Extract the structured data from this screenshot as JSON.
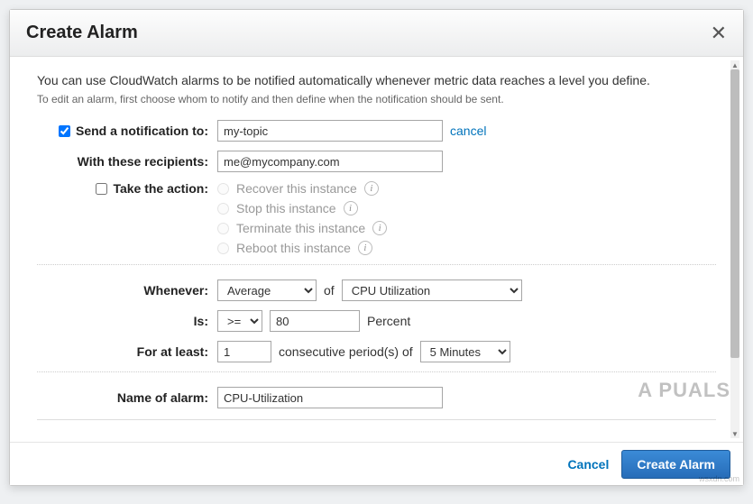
{
  "dialog": {
    "title": "Create Alarm",
    "close_label": "✕"
  },
  "intro": "You can use CloudWatch alarms to be notified automatically whenever metric data reaches a level you define.",
  "sub_intro": "To edit an alarm, first choose whom to notify and then define when the notification should be sent.",
  "notification": {
    "send_label": "Send a notification to:",
    "send_checked": true,
    "topic_value": "my-topic",
    "cancel_link": "cancel",
    "recipients_label": "With these recipients:",
    "recipients_value": "me@mycompany.com"
  },
  "action": {
    "take_label": "Take the action:",
    "take_checked": false,
    "options": {
      "recover": "Recover this instance",
      "stop": "Stop this instance",
      "terminate": "Terminate this instance",
      "reboot": "Reboot this instance"
    }
  },
  "threshold": {
    "whenever_label": "Whenever:",
    "statistic_value": "Average",
    "of_text": "of",
    "metric_value": "CPU Utilization",
    "is_label": "Is:",
    "operator_value": ">=",
    "threshold_value": "80",
    "percent_text": "Percent",
    "for_label": "For at least:",
    "periods_value": "1",
    "consecutive_text": "consecutive period(s) of",
    "period_value": "5 Minutes"
  },
  "name": {
    "label": "Name of alarm:",
    "value": "CPU-Utilization"
  },
  "footer": {
    "cancel": "Cancel",
    "create": "Create Alarm"
  },
  "watermark": "A  PUALS",
  "watermark2": "wsxdn.com"
}
